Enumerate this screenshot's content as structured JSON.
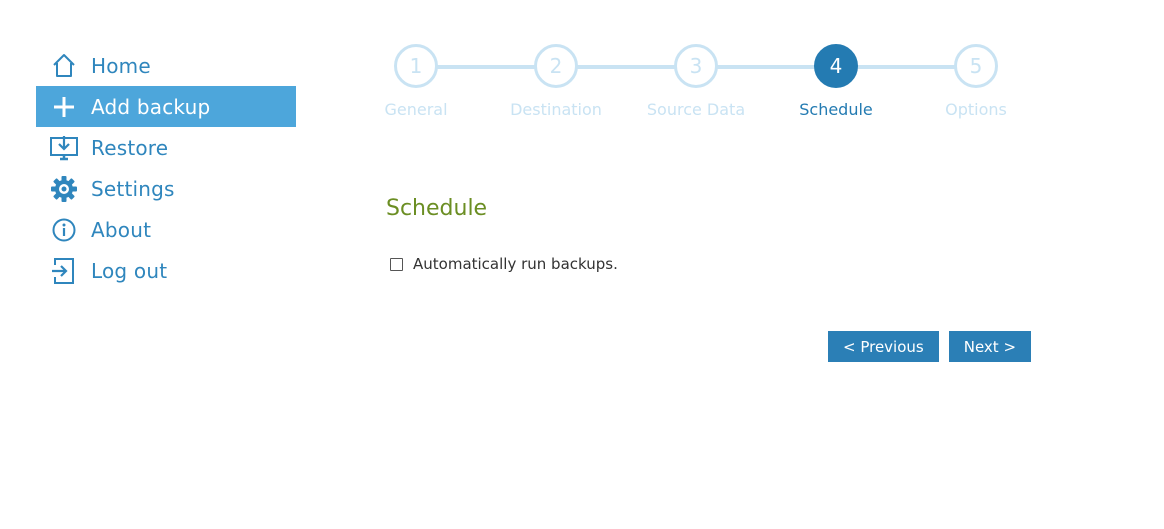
{
  "sidebar": {
    "items": [
      {
        "label": "Home",
        "icon": "home-icon",
        "active": false
      },
      {
        "label": "Add backup",
        "icon": "plus-icon",
        "active": true
      },
      {
        "label": "Restore",
        "icon": "restore-icon",
        "active": false
      },
      {
        "label": "Settings",
        "icon": "gear-icon",
        "active": false
      },
      {
        "label": "About",
        "icon": "info-icon",
        "active": false
      },
      {
        "label": "Log out",
        "icon": "logout-icon",
        "active": false
      }
    ]
  },
  "stepper": {
    "steps": [
      {
        "number": "1",
        "label": "General"
      },
      {
        "number": "2",
        "label": "Destination"
      },
      {
        "number": "3",
        "label": "Source Data"
      },
      {
        "number": "4",
        "label": "Schedule"
      },
      {
        "number": "5",
        "label": "Options"
      }
    ],
    "current": 4
  },
  "content": {
    "title": "Schedule",
    "auto_run_label": "Automatically run backups.",
    "auto_run_checked": false
  },
  "buttons": {
    "previous": "< Previous",
    "next": "Next >"
  },
  "colors": {
    "accent": "#2b7fb6",
    "active_nav": "#4da6db",
    "inactive_step": "#c9e3f3",
    "title_green": "#6b8e23"
  }
}
